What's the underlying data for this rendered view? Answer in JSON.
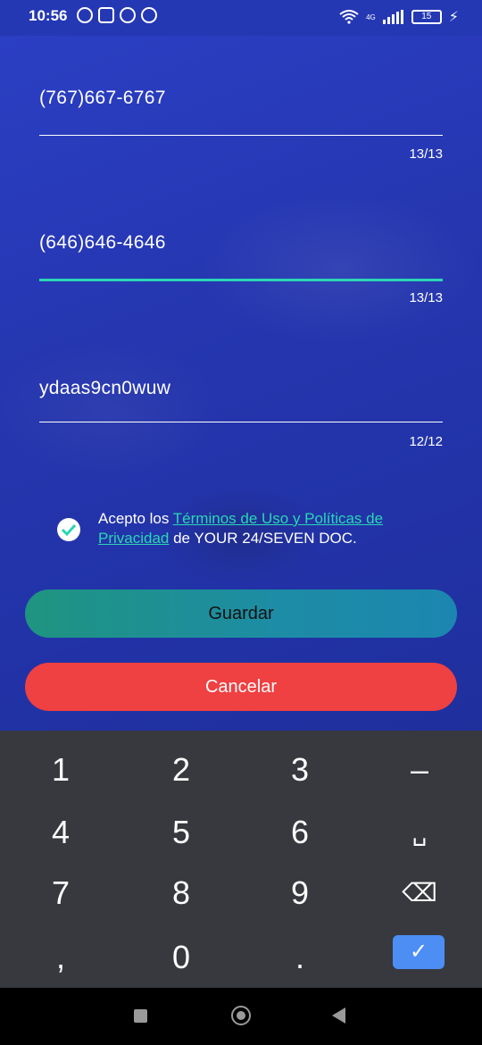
{
  "status": {
    "time": "10:56",
    "network": "4G",
    "battery": "15"
  },
  "form": {
    "phone1": {
      "value": "(767)667-6767",
      "counter": "13/13"
    },
    "phone2": {
      "value": "(646)646-4646",
      "counter": "13/13"
    },
    "code": {
      "value": "ydaas9cn0wuw",
      "counter": "12/12"
    }
  },
  "consent": {
    "prefix": "Acepto los ",
    "link": "Términos de Uso y Políticas de Privacidad",
    "suffix": " de YOUR 24/SEVEN DOC."
  },
  "buttons": {
    "save": "Guardar",
    "cancel": "Cancelar"
  },
  "keyboard": {
    "row1": [
      "1",
      "2",
      "3",
      "–"
    ],
    "row2": [
      "4",
      "5",
      "6",
      "␣"
    ],
    "row3": [
      "7",
      "8",
      "9",
      "⌫"
    ],
    "row4": [
      ",",
      "0",
      ".",
      "✓"
    ]
  },
  "colors": {
    "accent": "#2ad6b4",
    "cancel": "#ef4042",
    "keyboard_bg": "#37393e"
  }
}
